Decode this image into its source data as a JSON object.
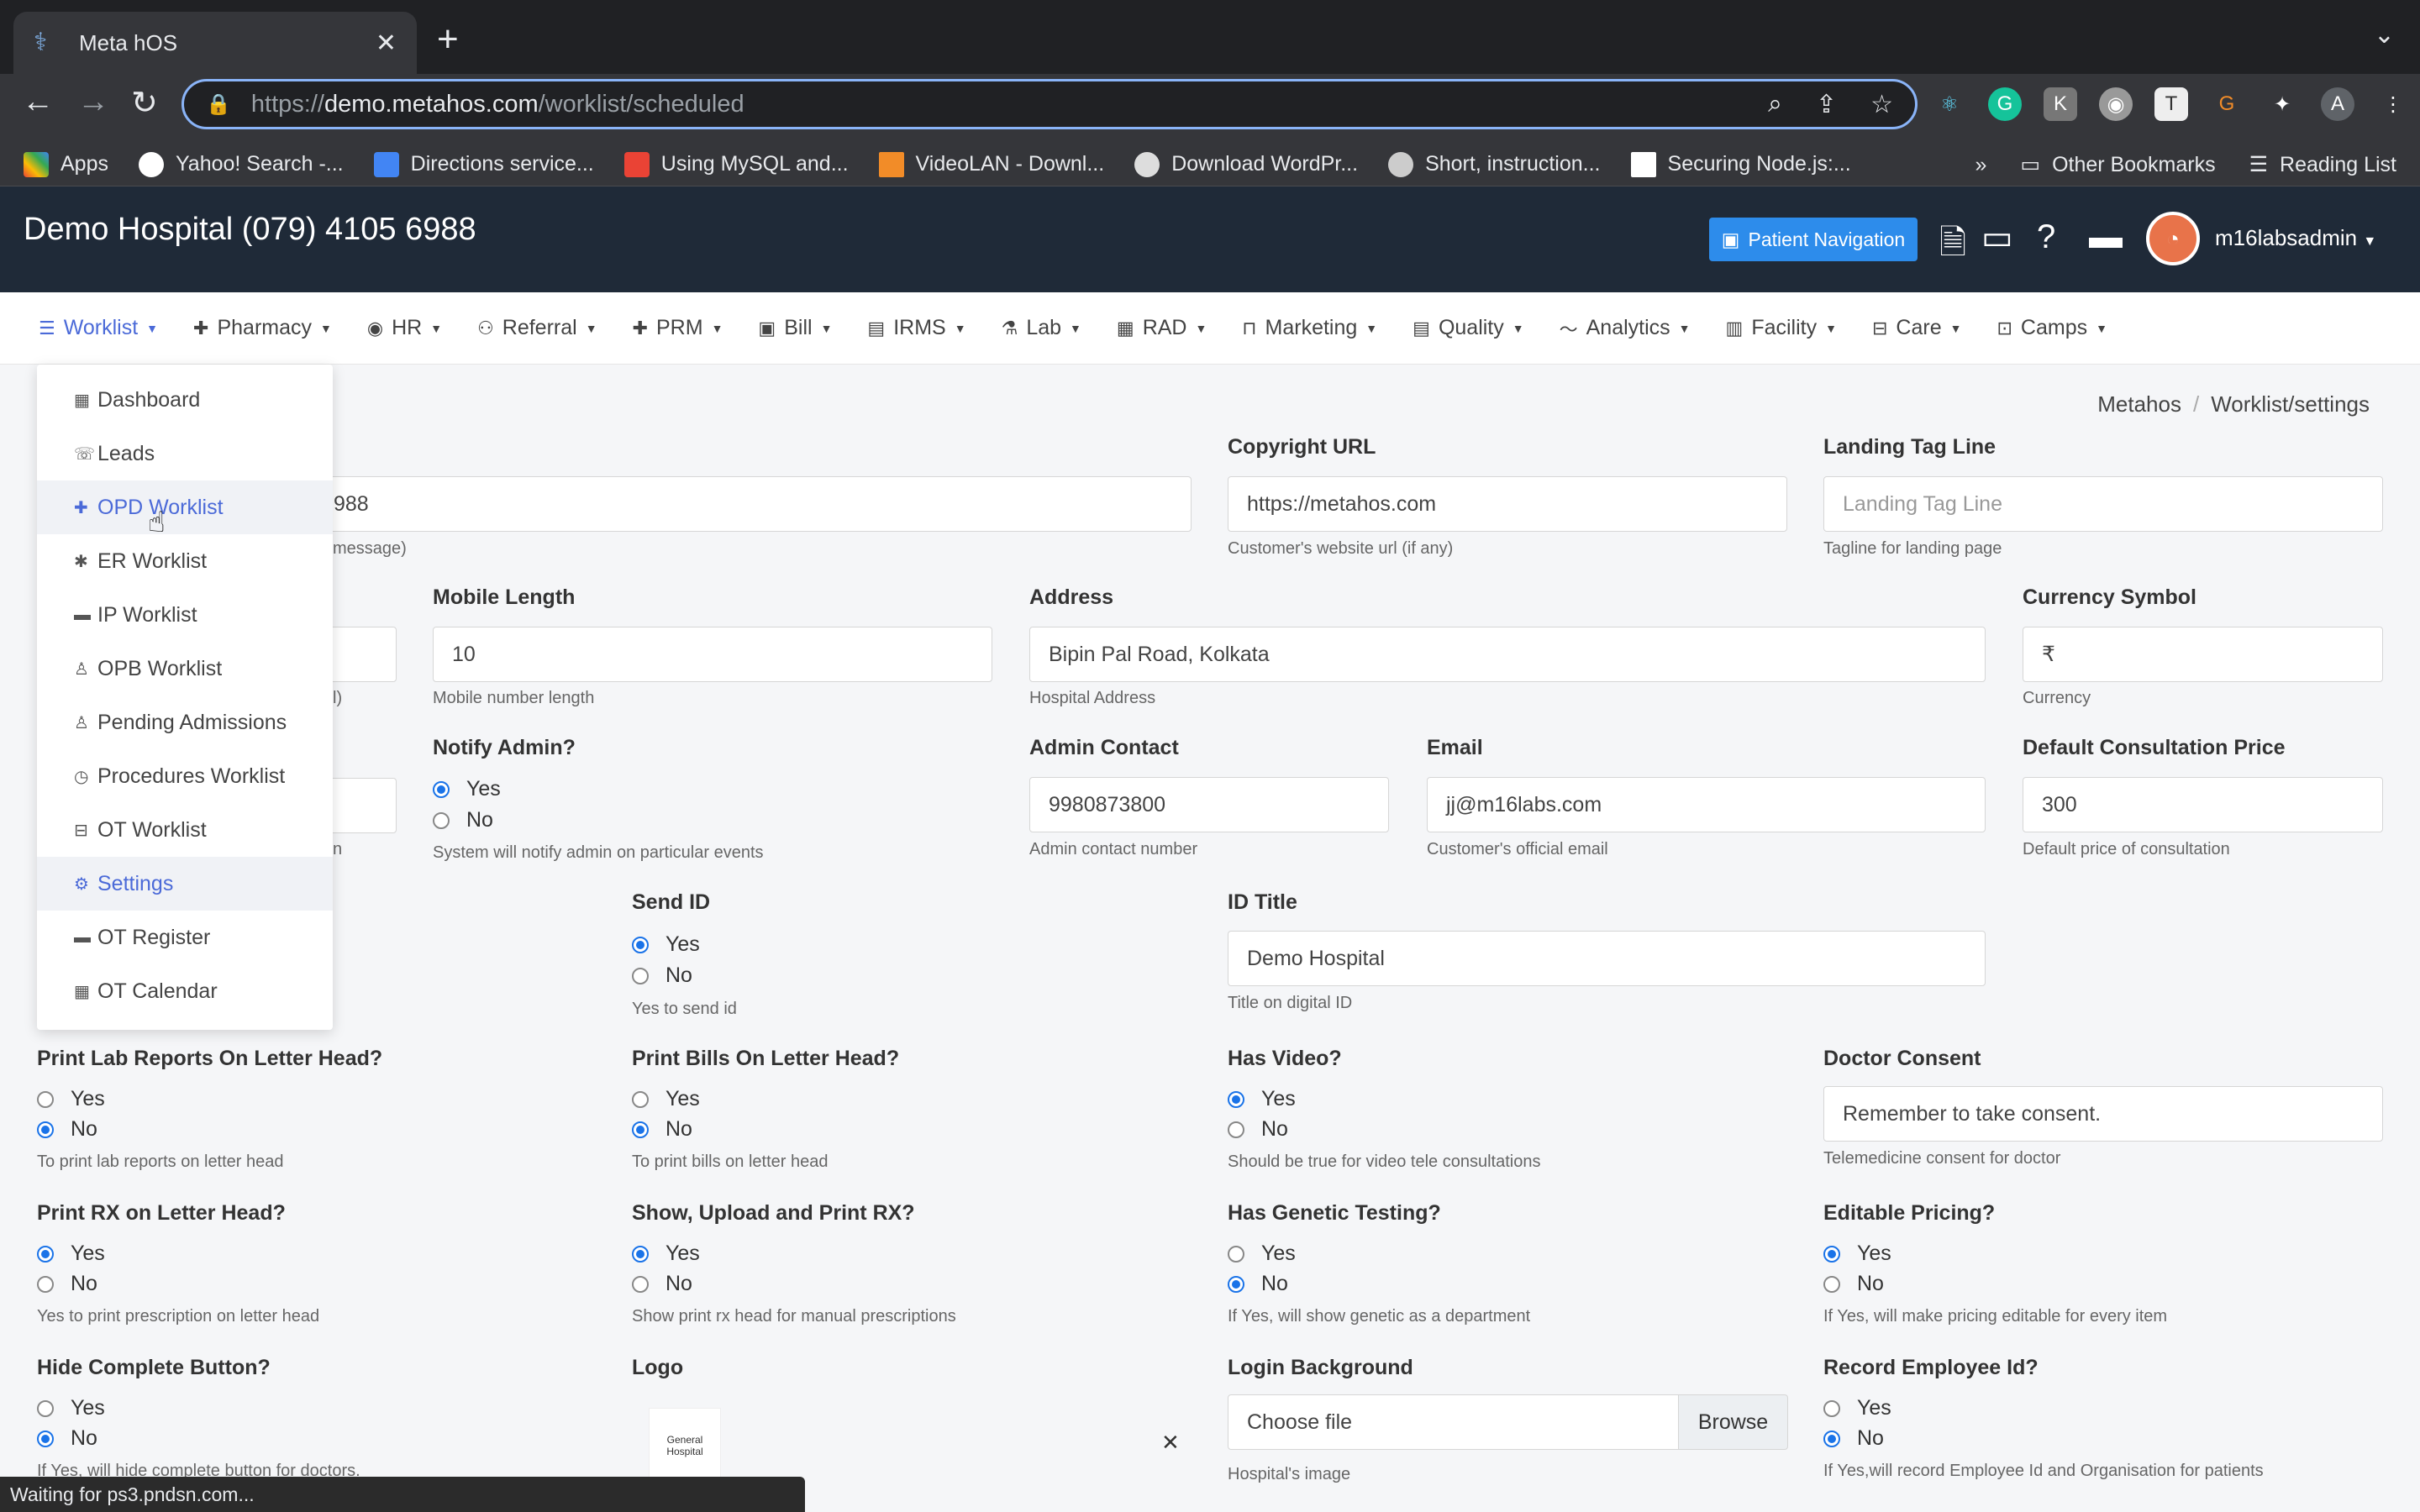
{
  "browser": {
    "tab_title": "Meta hOS",
    "url_prefix": "https://",
    "url_host": "demo.metahos.com",
    "url_path": "/worklist/scheduled",
    "status_text": "Waiting for ps3.pndsn.com...",
    "bookmarks": [
      "Apps",
      "Yahoo! Search -...",
      "Directions service...",
      "Using MySQL and...",
      "VideoLAN - Downl...",
      "Download WordPr...",
      "Short, instruction...",
      "Securing Node.js:..."
    ],
    "other_bookmarks": "Other Bookmarks",
    "reading_list": "Reading List",
    "profile_letter": "A"
  },
  "header": {
    "hospital": "Demo Hospital (079) 4105 6988",
    "patient_nav": "Patient Navigation",
    "username": "m16labsadmin"
  },
  "menu": [
    "Worklist",
    "Pharmacy",
    "HR",
    "Referral",
    "PRM",
    "Bill",
    "IRMS",
    "Lab",
    "RAD",
    "Marketing",
    "Quality",
    "Analytics",
    "Facility",
    "Care",
    "Camps"
  ],
  "dropdown": [
    "Dashboard",
    "Leads",
    "OPD Worklist",
    "ER Worklist",
    "IP Worklist",
    "OPB Worklist",
    "Pending Admissions",
    "Procedures Worklist",
    "OT Worklist",
    "Settings",
    "OT Register",
    "OT Calendar"
  ],
  "breadcrumb": {
    "root": "Metahos",
    "current": "Worklist/settings"
  },
  "form": {
    "phone_value_fragment": "988",
    "phone_hint_fragment": "message)",
    "row2_hint_fragment": "l)",
    "row3_hint_fragment": "n",
    "copyright_label": "Copyright URL",
    "copyright_value": "https://metahos.com",
    "copyright_hint": "Customer's website url (if any)",
    "landing_label": "Landing Tag Line",
    "landing_placeholder": "Landing Tag Line",
    "landing_hint": "Tagline for landing page",
    "mobile_label": "Mobile Length",
    "mobile_value": "10",
    "mobile_hint": "Mobile number length",
    "address_label": "Address",
    "address_value": "Bipin Pal Road, Kolkata",
    "address_hint": "Hospital Address",
    "currency_label": "Currency Symbol",
    "currency_value": "₹",
    "currency_hint": "Currency",
    "notify_label": "Notify Admin?",
    "notify_hint": "System will notify admin on particular events",
    "admin_label": "Admin Contact",
    "admin_value": "9980873800",
    "admin_hint": "Admin contact number",
    "email_label": "Email",
    "email_value": "jj@m16labs.com",
    "email_hint": "Customer's official email",
    "price_label": "Default Consultation Price",
    "price_value": "300",
    "price_hint": "Default price of consultation",
    "sendid_label": "Send ID",
    "sendid_hint": "Yes to send id",
    "idtitle_label": "ID Title",
    "idtitle_value": "Demo Hospital",
    "idtitle_hint": "Title on digital ID",
    "printlab_label": "Print Lab Reports On Letter Head?",
    "printlab_hint": "To print lab reports on letter head",
    "printbills_label": "Print Bills On Letter Head?",
    "printbills_hint": "To print bills on letter head",
    "video_label": "Has Video?",
    "video_hint": "Should be true for video tele consultations",
    "consent_label": "Doctor Consent",
    "consent_value": "Remember to take consent.",
    "consent_hint": "Telemedicine consent for doctor",
    "printrx_label": "Print RX on Letter Head?",
    "printrx_hint": "Yes to print prescription on letter head",
    "showrx_label": "Show, Upload and Print RX?",
    "showrx_hint": "Show print rx head for manual prescriptions",
    "genetic_label": "Has Genetic Testing?",
    "genetic_hint": "If Yes, will show genetic as a department",
    "pricing_label": "Editable Pricing?",
    "pricing_hint": "If Yes, will make pricing editable for every item",
    "hide_label": "Hide Complete Button?",
    "hide_hint": "If Yes, will hide complete button for doctors.",
    "logo_label": "Logo",
    "logo_text": "General Hospital",
    "loginbg_label": "Login Background",
    "loginbg_value": "Choose file",
    "browse_label": "Browse",
    "loginbg_hint": "Hospital's image",
    "recemp_label": "Record Employee Id?",
    "recemp_hint": "If Yes,will record Employee Id and Organisation for patients",
    "yes": "Yes",
    "no": "No"
  },
  "colors": {
    "accent": "#4b6ad8",
    "header_bg": "#1f2a38",
    "button_blue": "#2d8ceb"
  }
}
